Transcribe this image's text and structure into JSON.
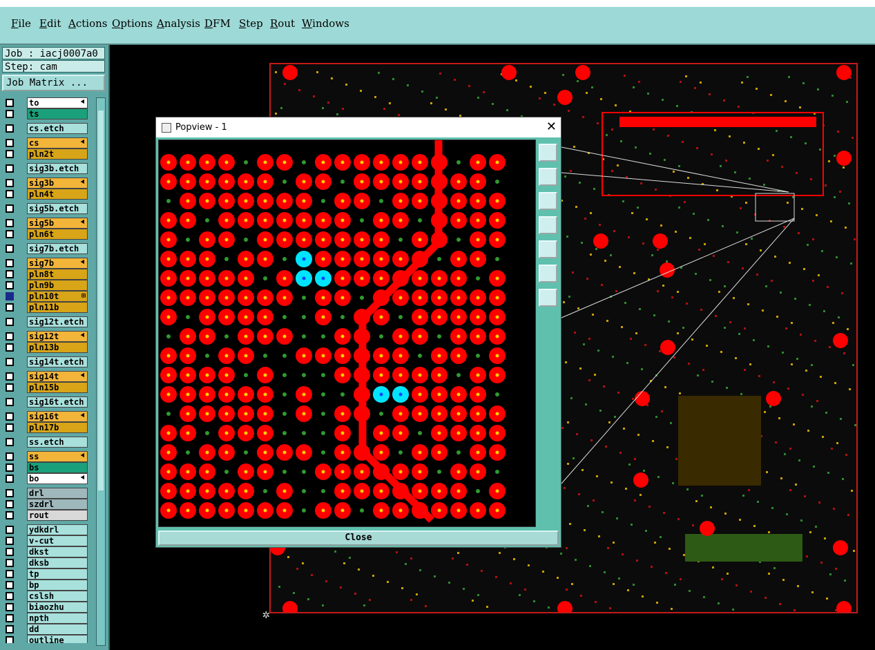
{
  "menubar": {
    "items": [
      {
        "label": "File"
      },
      {
        "label": "Edit"
      },
      {
        "label": "Actions"
      },
      {
        "label": "Options"
      },
      {
        "label": "Analysis"
      },
      {
        "label": "DFM"
      },
      {
        "label": "Step"
      },
      {
        "label": "Rout"
      },
      {
        "label": "Windows"
      }
    ]
  },
  "job": {
    "job_label": "Job : iacj0007a0",
    "step_label": "Step: cam",
    "matrix_button": "Job Matrix ..."
  },
  "layers": [
    {
      "name": "to",
      "color": "#ffffff",
      "mark": "⯇"
    },
    {
      "name": "ts",
      "color": "#1aa07a",
      "mark": ""
    },
    {
      "name": "cs.etch",
      "color": "#a8e0dc",
      "mark": ""
    },
    {
      "name": "cs",
      "color": "#f2b53a",
      "mark": "⯇"
    },
    {
      "name": "pln2t",
      "color": "#d8a418",
      "mark": ""
    },
    {
      "name": "sig3b.etch",
      "color": "#a8e0dc",
      "mark": ""
    },
    {
      "name": "sig3b",
      "color": "#f2b53a",
      "mark": "⯇"
    },
    {
      "name": "pln4t",
      "color": "#d8a418",
      "mark": ""
    },
    {
      "name": "sig5b.etch",
      "color": "#a8e0dc",
      "mark": ""
    },
    {
      "name": "sig5b",
      "color": "#f2b53a",
      "mark": "⯇"
    },
    {
      "name": "pln6t",
      "color": "#d8a418",
      "mark": ""
    },
    {
      "name": "sig7b.etch",
      "color": "#a8e0dc",
      "mark": ""
    },
    {
      "name": "sig7b",
      "color": "#f2b53a",
      "mark": "⯇"
    },
    {
      "name": "pln8t",
      "color": "#d8a418",
      "mark": ""
    },
    {
      "name": "pln9b",
      "color": "#d8a418",
      "mark": ""
    },
    {
      "name": "pln10t",
      "color": "#d8a418",
      "mark": "⊞",
      "active": true
    },
    {
      "name": "pln11b",
      "color": "#d8a418",
      "mark": ""
    },
    {
      "name": "sig12t.etch",
      "color": "#a8e0dc",
      "mark": ""
    },
    {
      "name": "sig12t",
      "color": "#f2b53a",
      "mark": "⯇"
    },
    {
      "name": "pln13b",
      "color": "#d8a418",
      "mark": ""
    },
    {
      "name": "sig14t.etch",
      "color": "#a8e0dc",
      "mark": ""
    },
    {
      "name": "sig14t",
      "color": "#f2b53a",
      "mark": "⯇"
    },
    {
      "name": "pln15b",
      "color": "#d8a418",
      "mark": ""
    },
    {
      "name": "sig16t.etch",
      "color": "#a8e0dc",
      "mark": ""
    },
    {
      "name": "sig16t",
      "color": "#f2b53a",
      "mark": "⯇"
    },
    {
      "name": "pln17b",
      "color": "#d8a418",
      "mark": ""
    },
    {
      "name": "ss.etch",
      "color": "#a8e0dc",
      "mark": ""
    },
    {
      "name": "ss",
      "color": "#f2b53a",
      "mark": "⯇"
    },
    {
      "name": "bs",
      "color": "#1aa07a",
      "mark": ""
    },
    {
      "name": "bo",
      "color": "#ffffff",
      "mark": "⯇"
    },
    {
      "name": "drl",
      "color": "#9fb8bc",
      "mark": ""
    },
    {
      "name": "szdrl",
      "color": "#9fb8bc",
      "mark": ""
    },
    {
      "name": "rout",
      "color": "#d8d8d8",
      "mark": ""
    },
    {
      "name": "ydkdrl",
      "color": "#a8e0dc",
      "mark": ""
    },
    {
      "name": "v-cut",
      "color": "#a8e0dc",
      "mark": ""
    },
    {
      "name": "dkst",
      "color": "#a8e0dc",
      "mark": ""
    },
    {
      "name": "dksb",
      "color": "#a8e0dc",
      "mark": ""
    },
    {
      "name": "tp",
      "color": "#a8e0dc",
      "mark": ""
    },
    {
      "name": "bp",
      "color": "#a8e0dc",
      "mark": ""
    },
    {
      "name": "cslsh",
      "color": "#a8e0dc",
      "mark": ""
    },
    {
      "name": "biaozhu",
      "color": "#a8e0dc",
      "mark": ""
    },
    {
      "name": "npth",
      "color": "#a8e0dc",
      "mark": ""
    },
    {
      "name": "dd",
      "color": "#a8e0dc",
      "mark": ""
    },
    {
      "name": "outline",
      "color": "#a8e0dc",
      "mark": ""
    }
  ],
  "popview": {
    "title": "Popview - 1",
    "close_label": "Close",
    "close_icon": "✕"
  },
  "colors": {
    "pad": "#ff0000",
    "via_highlight": "#00e5ff",
    "small_via": "#2f9a2f"
  }
}
